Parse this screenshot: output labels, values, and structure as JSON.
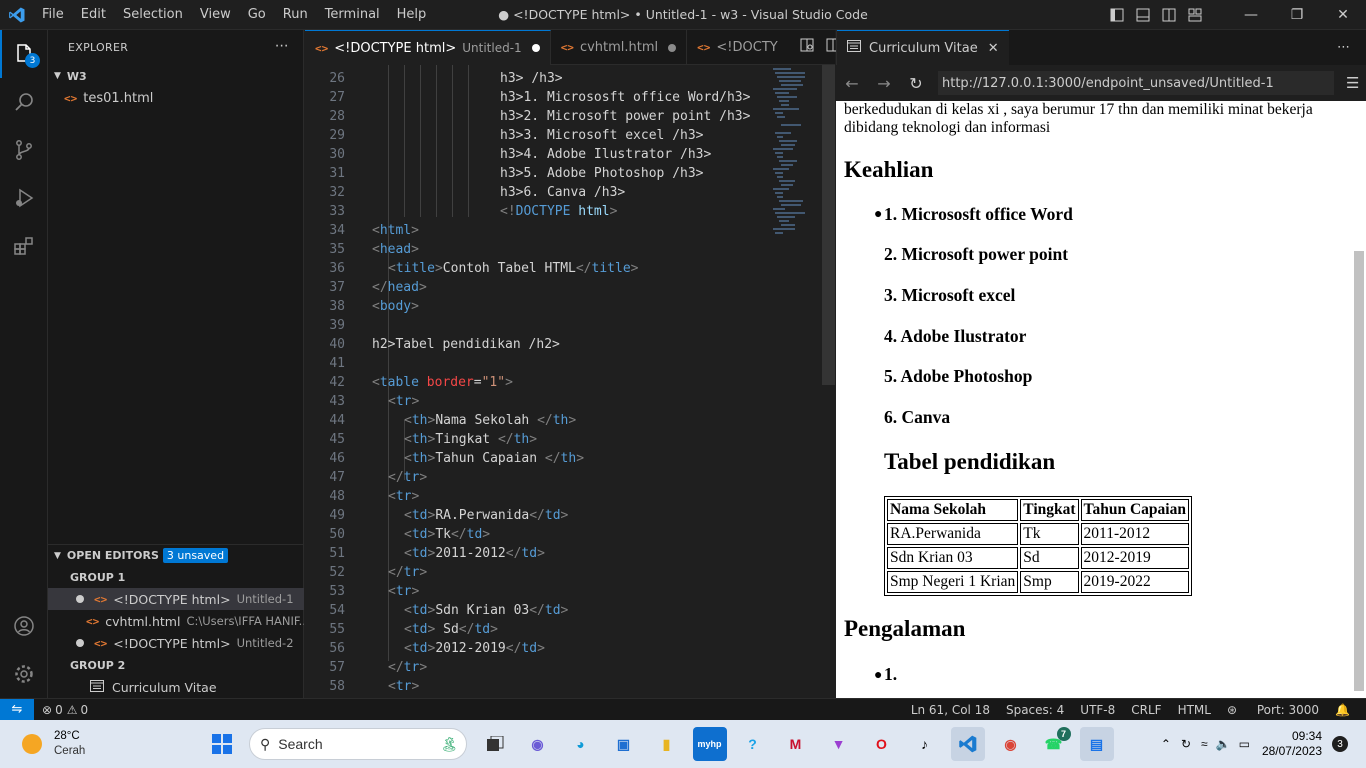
{
  "window": {
    "title": "● <!DOCTYPE html> • Untitled-1 - w3 - Visual Studio Code",
    "menu": [
      "File",
      "Edit",
      "Selection",
      "View",
      "Go",
      "Run",
      "Terminal",
      "Help"
    ]
  },
  "activity": {
    "explorer_badge": "3"
  },
  "sidebar": {
    "title": "EXPLORER",
    "folder": "W3",
    "files": [
      "tes01.html"
    ],
    "open_editors": {
      "label": "OPEN EDITORS",
      "badge": "3 unsaved",
      "group1": "GROUP 1",
      "group2": "GROUP 2",
      "items": [
        {
          "name": "<!DOCTYPE html>",
          "desc": "Untitled-1"
        },
        {
          "name": "cvhtml.html",
          "desc": "C:\\Users\\IFFA HANIF..."
        },
        {
          "name": "<!DOCTYPE html>",
          "desc": "Untitled-2"
        }
      ],
      "group2_item": "Curriculum Vitae"
    }
  },
  "editor": {
    "tabs": [
      {
        "label": "<!DOCTYPE html>",
        "desc": "Untitled-1"
      },
      {
        "label": "cvhtml.html",
        "desc": ""
      },
      {
        "label": "<!DOCTY",
        "desc": ""
      }
    ],
    "lines": [
      {
        "n": "26",
        "text": "<h3> </h3>"
      },
      {
        "n": "27",
        "text": "<h3>1. Micrososft office Word</h3>"
      },
      {
        "n": "28",
        "text": "<h3>2. Microsoft power point </h3>"
      },
      {
        "n": "29",
        "text": "<h3>3. Microsoft excel </h3>"
      },
      {
        "n": "30",
        "text": "<h3>4. Adobe Ilustrator </h3>"
      },
      {
        "n": "31",
        "text": "<h3>5. Adobe Photoshop </h3>"
      },
      {
        "n": "32",
        "text": "<h3>6. Canva </h3>"
      },
      {
        "n": "33",
        "text": "<!DOCTYPE html>"
      },
      {
        "n": "34",
        "text": "<html>"
      },
      {
        "n": "35",
        "text": "<head>"
      },
      {
        "n": "36",
        "text": "<title>Contoh Tabel HTML</title>"
      },
      {
        "n": "37",
        "text": "</head>"
      },
      {
        "n": "38",
        "text": "<body>"
      },
      {
        "n": "39",
        "text": ""
      },
      {
        "n": "40",
        "text": "<h2>Tabel pendidikan </h2>"
      },
      {
        "n": "41",
        "text": ""
      },
      {
        "n": "42",
        "text": "<table border=\"1\">"
      },
      {
        "n": "43",
        "text": "<tr>"
      },
      {
        "n": "44",
        "text": "<th>Nama Sekolah </th>"
      },
      {
        "n": "45",
        "text": "<th>Tingkat </th>"
      },
      {
        "n": "46",
        "text": "<th>Tahun Capaian </th>"
      },
      {
        "n": "47",
        "text": "</tr>"
      },
      {
        "n": "48",
        "text": "<tr>"
      },
      {
        "n": "49",
        "text": "<td>RA.Perwanida</td>"
      },
      {
        "n": "50",
        "text": "<td>Tk</td>"
      },
      {
        "n": "51",
        "text": "<td>2011-2012</td>"
      },
      {
        "n": "52",
        "text": "</tr>"
      },
      {
        "n": "53",
        "text": "<tr>"
      },
      {
        "n": "54",
        "text": "<td>Sdn Krian 03</td>"
      },
      {
        "n": "55",
        "text": "<td> Sd</td>"
      },
      {
        "n": "56",
        "text": "<td>2012-2019</td>"
      },
      {
        "n": "57",
        "text": "</tr>"
      },
      {
        "n": "58",
        "text": "<tr>"
      }
    ]
  },
  "preview": {
    "tab_label": "Curriculum Vitae",
    "url": "http://127.0.0.1:3000/endpoint_unsaved/Untitled-1",
    "intro_line1": "berkedudukan di kelas xi , saya berumur 17 thn dan memiliki minat bekerja",
    "intro_line2": "dibidang teknologi dan informasi",
    "skills_heading": "Keahlian",
    "skills": [
      "1. Micrososft office Word",
      "2. Microsoft power point",
      "3. Microsoft excel",
      "4. Adobe Ilustrator",
      "5. Adobe Photoshop",
      "6. Canva"
    ],
    "table_heading": "Tabel pendidikan",
    "table_headers": [
      "Nama Sekolah",
      "Tingkat",
      "Tahun Capaian"
    ],
    "table_rows": [
      [
        "RA.Perwanida",
        "Tk",
        "2011-2012"
      ],
      [
        "Sdn Krian 03",
        "Sd",
        "2012-2019"
      ],
      [
        "Smp Negeri 1 Krian",
        "Smp",
        "2019-2022"
      ]
    ],
    "exp_heading": "Pengalaman",
    "exp_item": "1."
  },
  "status": {
    "errors": "0",
    "warnings": "0",
    "position": "Ln 61, Col 18",
    "spaces": "Spaces: 4",
    "encoding": "UTF-8",
    "eol": "CRLF",
    "language": "HTML",
    "port": "Port: 3000"
  },
  "taskbar": {
    "temp": "28°C",
    "weather": "Cerah",
    "search": "Search",
    "time": "09:34",
    "date": "28/07/2023",
    "notifications": "3",
    "whatsapp_badge": "7"
  }
}
